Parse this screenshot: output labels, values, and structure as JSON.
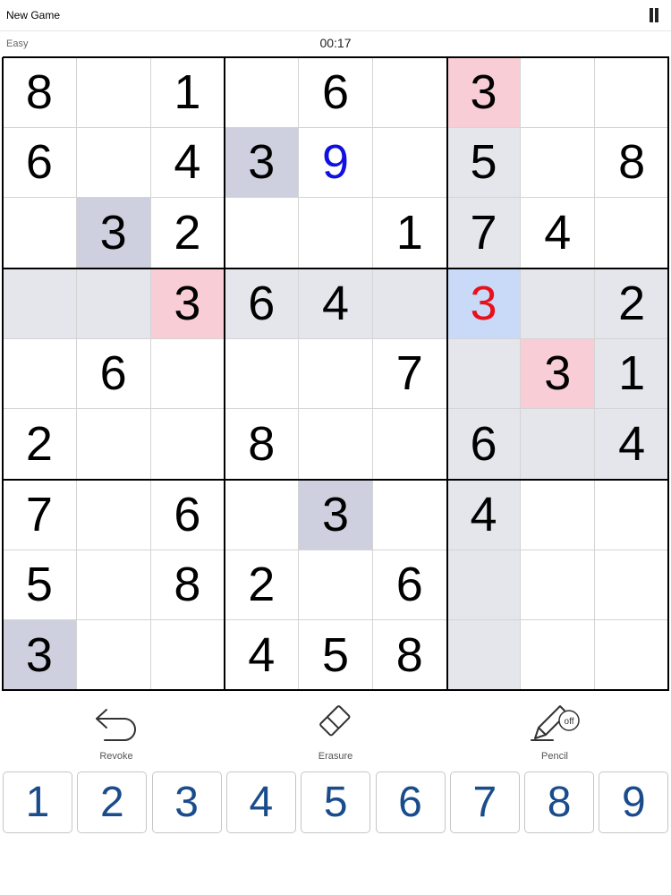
{
  "header": {
    "new_game_label": "New Game",
    "pause_icon": "pause-icon"
  },
  "status": {
    "difficulty": "Easy",
    "timer": "00:17"
  },
  "board": {
    "grid": [
      [
        "8",
        "",
        "1",
        "",
        "6",
        "",
        "3",
        "",
        ""
      ],
      [
        "6",
        "",
        "4",
        "3",
        "9",
        "",
        "5",
        "",
        "8"
      ],
      [
        "",
        "3",
        "2",
        "",
        "",
        "1",
        "7",
        "4",
        ""
      ],
      [
        "",
        "",
        "3",
        "6",
        "4",
        "",
        "3",
        "",
        "2"
      ],
      [
        "",
        "6",
        "",
        "",
        "",
        "7",
        "",
        "3",
        "1"
      ],
      [
        "2",
        "",
        "",
        "8",
        "",
        "",
        "6",
        "",
        "4"
      ],
      [
        "7",
        "",
        "6",
        "",
        "3",
        "",
        "4",
        "",
        ""
      ],
      [
        "5",
        "",
        "8",
        "2",
        "",
        "6",
        "",
        "",
        ""
      ],
      [
        "3",
        "",
        "",
        "4",
        "5",
        "8",
        "",
        "",
        ""
      ]
    ],
    "selected_cell": {
      "row": 4,
      "col": 7
    },
    "user_entered_cells": [
      {
        "row": 2,
        "col": 5
      }
    ],
    "error_cells": [
      {
        "row": 4,
        "col": 7
      }
    ],
    "conflict_cells": [
      {
        "row": 1,
        "col": 7
      },
      {
        "row": 4,
        "col": 3
      },
      {
        "row": 5,
        "col": 8
      }
    ],
    "same_number_cells": [
      {
        "row": 2,
        "col": 4
      },
      {
        "row": 3,
        "col": 2
      },
      {
        "row": 7,
        "col": 5
      },
      {
        "row": 9,
        "col": 1
      }
    ],
    "highlighted_row": 4,
    "highlighted_col": 7,
    "colors": {
      "given_digit": "#000000",
      "user_digit": "#1010e0",
      "error_digit": "#e8101a",
      "related_bg": "#e4e6ec",
      "same_number_bg": "#cfd0df",
      "conflict_bg": "#f8cdd6",
      "selected_bg": "#c8daf8"
    }
  },
  "tools": [
    {
      "label": "Revoke",
      "icon": "undo-arrow-icon"
    },
    {
      "label": "Erasure",
      "icon": "eraser-icon"
    },
    {
      "label": "Pencil",
      "icon": "pencil-off-icon",
      "badge": "off"
    }
  ],
  "numpad": {
    "keys": [
      "1",
      "2",
      "3",
      "4",
      "5",
      "6",
      "7",
      "8",
      "9"
    ],
    "color": "#1a4c8c"
  }
}
